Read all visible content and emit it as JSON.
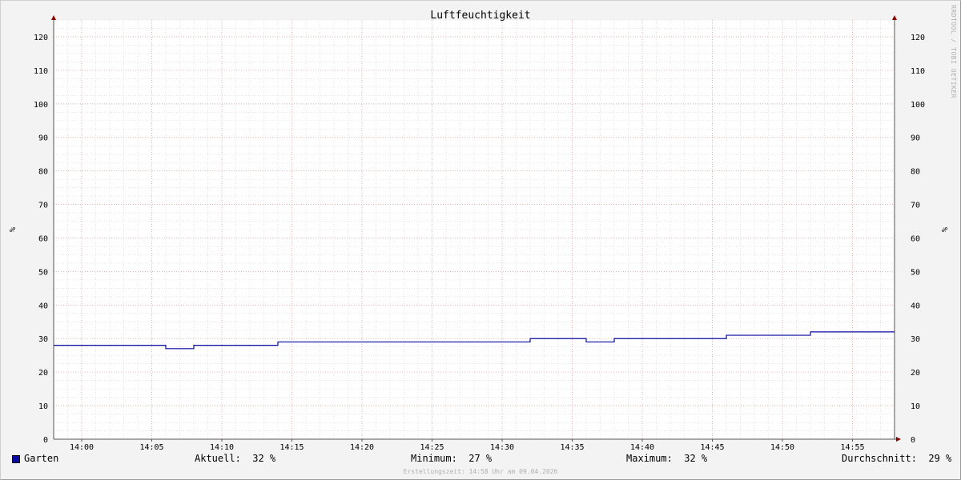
{
  "chart_data": {
    "type": "line",
    "title": "Luftfeuchtigkeit",
    "ylabel": "%",
    "ylim": [
      0,
      125
    ],
    "y_ticks": [
      0,
      10,
      20,
      30,
      40,
      50,
      60,
      70,
      80,
      90,
      100,
      110,
      120
    ],
    "x_ticks": [
      "14:00",
      "14:05",
      "14:10",
      "14:15",
      "14:20",
      "14:25",
      "14:30",
      "14:35",
      "14:40",
      "14:45",
      "14:50",
      "14:55"
    ],
    "grid": true,
    "series": [
      {
        "name": "Garten",
        "color": "#0a0aa0",
        "step": true,
        "points": [
          [
            "13:58",
            28
          ],
          [
            "14:06",
            27
          ],
          [
            "14:08",
            28
          ],
          [
            "14:14",
            29
          ],
          [
            "14:32",
            30
          ],
          [
            "14:36",
            29
          ],
          [
            "14:38",
            30
          ],
          [
            "14:46",
            31
          ],
          [
            "14:52",
            32
          ],
          [
            "14:58",
            32
          ]
        ]
      }
    ]
  },
  "legend": {
    "series_name": "Garten",
    "current": "Aktuell:  32 %",
    "minimum": "Minimum:  27 %",
    "maximum": "Maximum:  32 %",
    "average": "Durchschnitt:  29 %"
  },
  "footer": "Erstellungszeit: 14:58 Uhr am 09.04.2026",
  "watermark": "RRDTOOL / TOBI OETIKER"
}
